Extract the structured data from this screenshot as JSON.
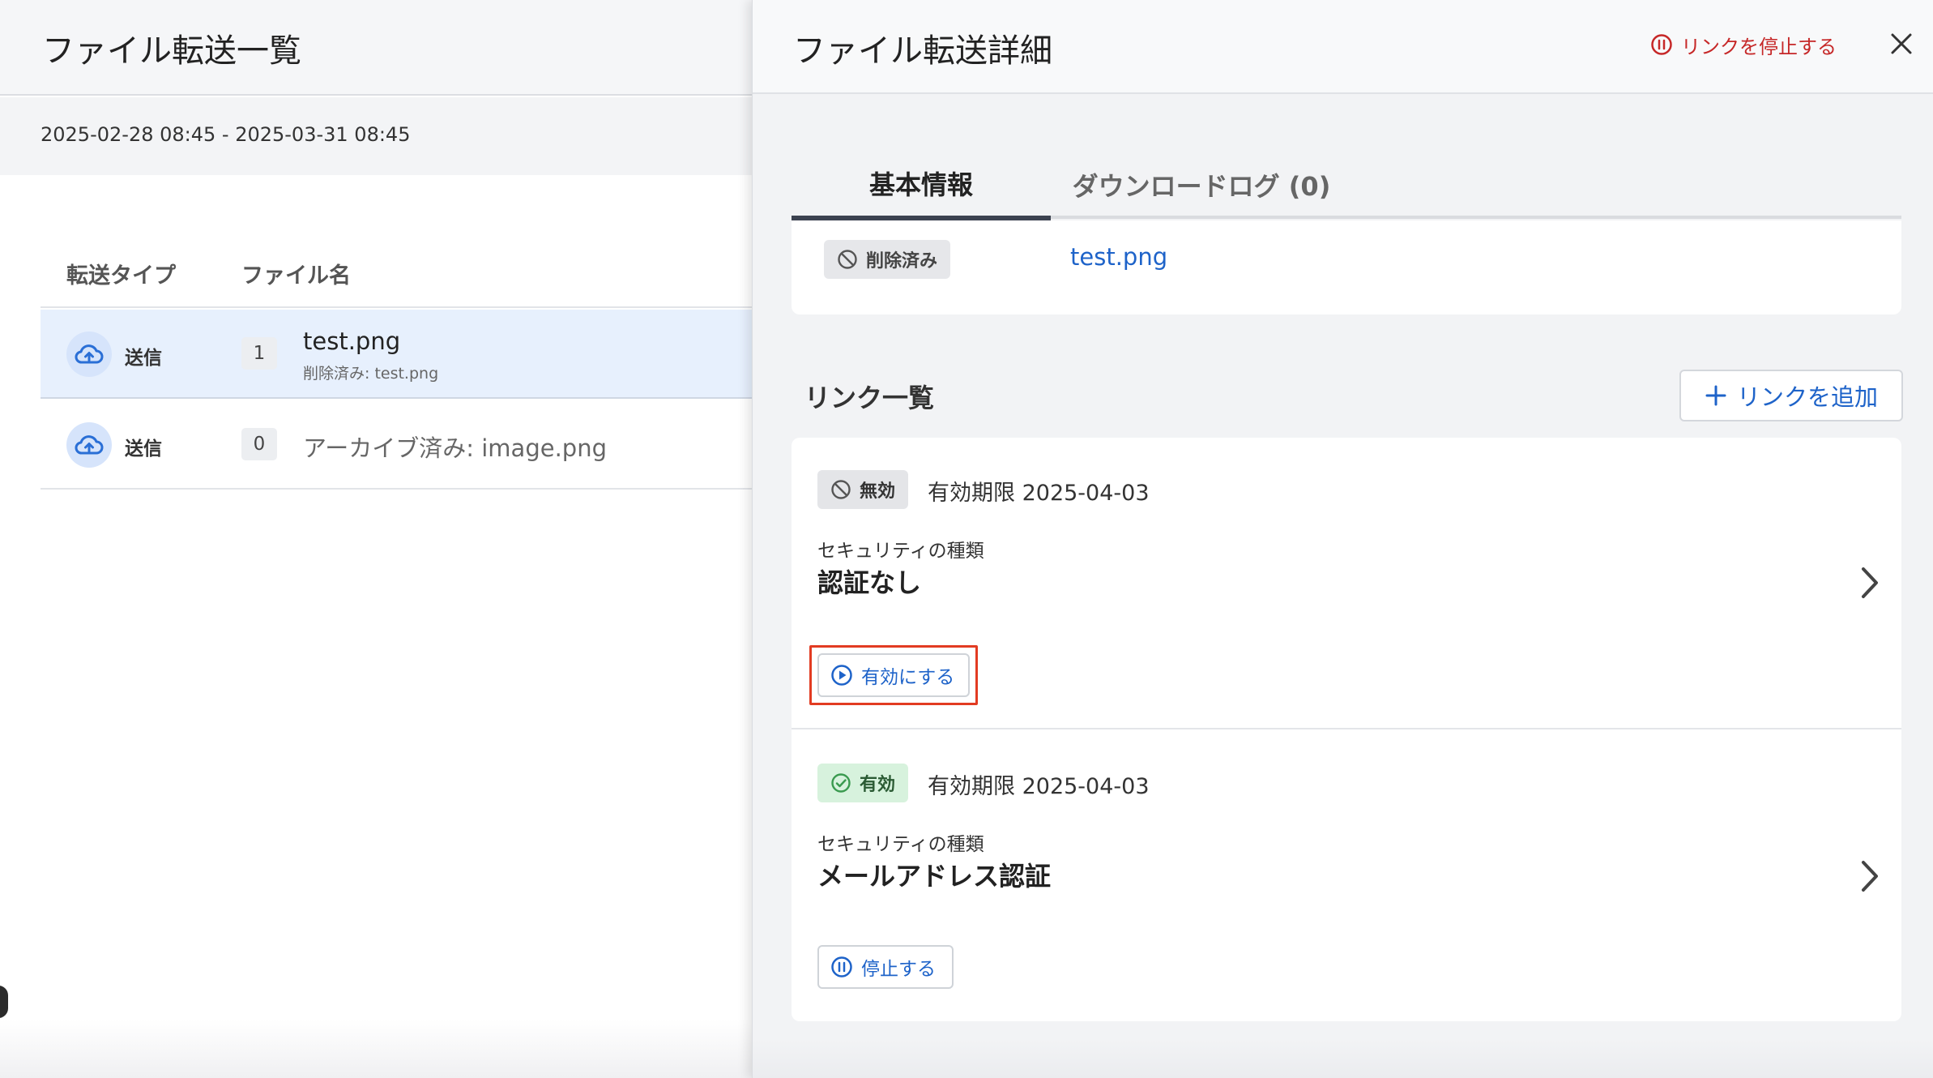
{
  "left": {
    "title": "ファイル転送一覧",
    "date_range": "2025-02-28 08:45 - 2025-03-31 08:45",
    "columns": {
      "type": "転送タイプ",
      "name": "ファイル名"
    },
    "rows": [
      {
        "type": "送信",
        "count": "1",
        "file_name": "test.png",
        "sub": "削除済み: test.png"
      },
      {
        "type": "送信",
        "count": "0",
        "file_name": "アーカイブ済み: image.png"
      }
    ]
  },
  "detail": {
    "title": "ファイル転送詳細",
    "stop_link_label": "リンクを停止する",
    "tabs": [
      {
        "label": "基本情報"
      },
      {
        "label": "ダウンロードログ (0)"
      }
    ],
    "file": {
      "status": "削除済み",
      "name": "test.png"
    },
    "links_title": "リンク一覧",
    "add_link_label": "リンクを追加",
    "links": [
      {
        "status": "無効",
        "expiry": "有効期限 2025-04-03",
        "security_label": "セキュリティの種類",
        "security_value": "認証なし",
        "action_label": "有効にする"
      },
      {
        "status": "有効",
        "expiry": "有効期限 2025-04-03",
        "security_label": "セキュリティの種類",
        "security_value": "メールアドレス認証",
        "action_label": "停止する"
      }
    ]
  },
  "colors": {
    "accent_blue": "#1e63c9",
    "danger_red": "#c62828",
    "highlight_frame": "#e23b22",
    "valid_green_bg": "#d7f2dd",
    "selected_row": "#e7f0fd"
  }
}
